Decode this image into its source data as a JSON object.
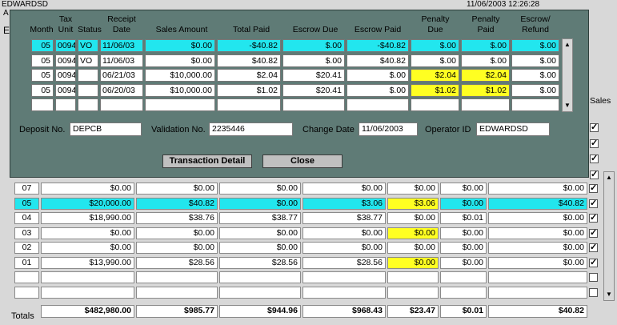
{
  "topbar": {
    "operator": "EDWARDSD",
    "datetime": "11/06/2003 12:26:28",
    "sub_a": "A",
    "sub_e": "E"
  },
  "bg_grid": {
    "sales_header": "Sales",
    "rows": [
      {
        "month": "07",
        "sales": "$0.00",
        "tax": "$0.00",
        "paid": "$0.00",
        "escrow_due": "$0.00",
        "penalty_due": "$0.00",
        "penalty_paid": "$0.00",
        "refund": "$0.00",
        "checked": true,
        "highlight": "",
        "pen_yellow": false
      },
      {
        "month": "05",
        "sales": "$20,000.00",
        "tax": "$40.82",
        "paid": "$0.00",
        "escrow_due": "$3.06",
        "penalty_due": "$3.06",
        "penalty_paid": "$0.00",
        "refund": "$40.82",
        "checked": true,
        "highlight": "cyan",
        "pen_yellow": true
      },
      {
        "month": "04",
        "sales": "$18,990.00",
        "tax": "$38.76",
        "paid": "$38.77",
        "escrow_due": "$38.77",
        "penalty_due": "$0.00",
        "penalty_paid": "$0.01",
        "refund": "$0.00",
        "checked": true,
        "highlight": "",
        "pen_yellow": false
      },
      {
        "month": "03",
        "sales": "$0.00",
        "tax": "$0.00",
        "paid": "$0.00",
        "escrow_due": "$0.00",
        "penalty_due": "$0.00",
        "penalty_paid": "$0.00",
        "refund": "$0.00",
        "checked": true,
        "highlight": "",
        "pen_yellow": true
      },
      {
        "month": "02",
        "sales": "$0.00",
        "tax": "$0.00",
        "paid": "$0.00",
        "escrow_due": "$0.00",
        "penalty_due": "$0.00",
        "penalty_paid": "$0.00",
        "refund": "$0.00",
        "checked": true,
        "highlight": "",
        "pen_yellow": false
      },
      {
        "month": "01",
        "sales": "$13,990.00",
        "tax": "$28.56",
        "paid": "$28.56",
        "escrow_due": "$28.56",
        "penalty_due": "$0.00",
        "penalty_paid": "$0.00",
        "refund": "$0.00",
        "checked": true,
        "highlight": "",
        "pen_yellow": true
      },
      {
        "month": "",
        "sales": "",
        "tax": "",
        "paid": "",
        "escrow_due": "",
        "penalty_due": "",
        "penalty_paid": "",
        "refund": "",
        "checked": false,
        "highlight": "",
        "pen_yellow": false
      },
      {
        "month": "",
        "sales": "",
        "tax": "",
        "paid": "",
        "escrow_due": "",
        "penalty_due": "",
        "penalty_paid": "",
        "refund": "",
        "checked": false,
        "highlight": "",
        "pen_yellow": false
      }
    ],
    "upper_checks": [
      true,
      true,
      true,
      true
    ],
    "totals_label": "Totals",
    "totals": {
      "sales": "$482,980.00",
      "tax": "$985.77",
      "paid": "$944.96",
      "escrow_due": "$968.43",
      "penalty_due": "$23.47",
      "penalty_paid": "$0.01",
      "refund": "$40.82"
    }
  },
  "modal": {
    "headers": {
      "month": "Month",
      "tax_unit": "Tax\nUnit",
      "status": "Status",
      "receipt_date": "Receipt\nDate",
      "sales_amount": "Sales Amount",
      "total_paid": "Total Paid",
      "escrow_due": "Escrow Due",
      "escrow_paid": "Escrow Paid",
      "penalty_due": "Penalty\nDue",
      "penalty_paid": "Penalty\nPaid",
      "escrow_refund": "Escrow/\nRefund"
    },
    "rows": [
      {
        "month": "05",
        "tax_unit": "0094",
        "status": "VO",
        "date": "11/06/03",
        "sales": "$0.00",
        "total_paid": "-$40.82",
        "escrow_due": "$.00",
        "escrow_paid": "-$40.82",
        "penalty_due": "$.00",
        "penalty_paid": "$.00",
        "refund": "$.00",
        "highlight": "cyan",
        "pen_yellow": false
      },
      {
        "month": "05",
        "tax_unit": "0094",
        "status": "VO",
        "date": "11/06/03",
        "sales": "$0.00",
        "total_paid": "$40.82",
        "escrow_due": "$.00",
        "escrow_paid": "$40.82",
        "penalty_due": "$.00",
        "penalty_paid": "$.00",
        "refund": "$.00",
        "highlight": "",
        "pen_yellow": false
      },
      {
        "month": "05",
        "tax_unit": "0094",
        "status": "",
        "date": "06/21/03",
        "sales": "$10,000.00",
        "total_paid": "$2.04",
        "escrow_due": "$20.41",
        "escrow_paid": "$.00",
        "penalty_due": "$2.04",
        "penalty_paid": "$2.04",
        "refund": "$.00",
        "highlight": "",
        "pen_yellow": true
      },
      {
        "month": "05",
        "tax_unit": "0094",
        "status": "",
        "date": "06/20/03",
        "sales": "$10,000.00",
        "total_paid": "$1.02",
        "escrow_due": "$20.41",
        "escrow_paid": "$.00",
        "penalty_due": "$1.02",
        "penalty_paid": "$1.02",
        "refund": "$.00",
        "highlight": "",
        "pen_yellow": true
      },
      {
        "month": "",
        "tax_unit": "",
        "status": "",
        "date": "",
        "sales": "",
        "total_paid": "",
        "escrow_due": "",
        "escrow_paid": "",
        "penalty_due": "",
        "penalty_paid": "",
        "refund": "",
        "highlight": "",
        "pen_yellow": false
      }
    ],
    "deposit_label": "Deposit No.",
    "deposit_value": "DEPCB",
    "validation_label": "Validation No.",
    "validation_value": "2235446",
    "change_date_label": "Change Date",
    "change_date_value": "11/06/2003",
    "operator_label": "Operator ID",
    "operator_value": "EDWARDSD",
    "transaction_detail_btn": "Transaction Detail",
    "close_btn": "Close"
  },
  "colors": {
    "modal_bg": "#5f7b76",
    "highlight_cyan": "#22e6ee",
    "highlight_yellow": "#ffff22"
  }
}
